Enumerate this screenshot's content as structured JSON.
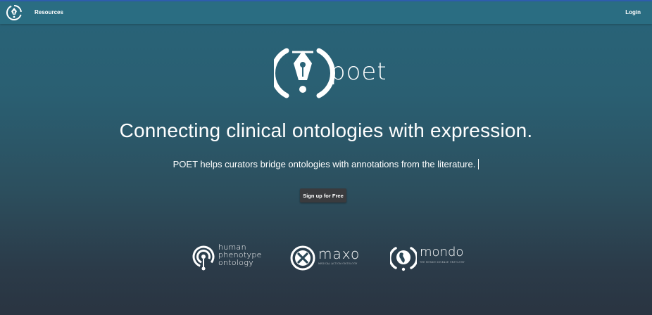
{
  "nav": {
    "logo_icon": "poet-pen-logo-icon",
    "resources_label": "Resources",
    "login_label": "Login"
  },
  "hero": {
    "brand_text": "poet",
    "headline": "Connecting clinical ontologies with expression.",
    "subheadline": "POET helps curators bridge ontologies with annotations from the literature.",
    "cta_label": "Sign up for Free"
  },
  "partners": {
    "hpo": {
      "line1": "human",
      "line2": "phenotype",
      "line3": "ontology"
    },
    "maxo": {
      "name": "maxo",
      "tagline": "MEDICAL ACTION ONTOLOGY"
    },
    "mondo": {
      "name": "mondo",
      "tagline": "THE MONDO DISEASE ONTOLOGY"
    }
  },
  "colors": {
    "navbar": "#2a6d82",
    "button": "#3a3b3e",
    "background_top": "#286479",
    "background_bottom": "#2a3441"
  }
}
